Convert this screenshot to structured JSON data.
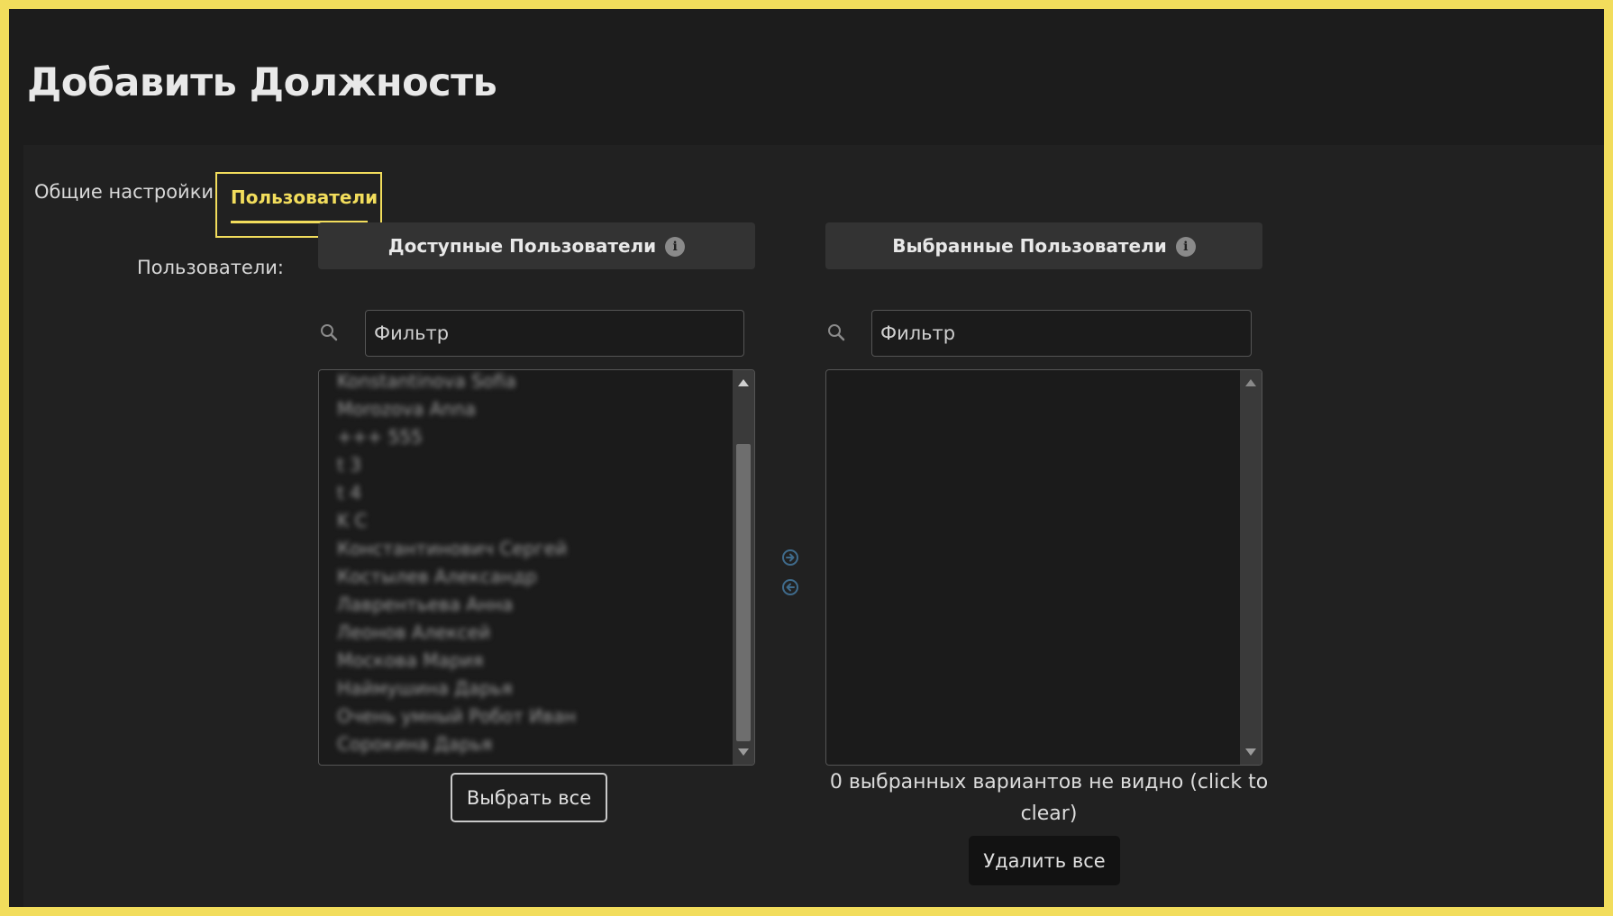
{
  "page": {
    "title": "Добавить Должность"
  },
  "tabs": [
    {
      "label": "Общие настройки",
      "active": false
    },
    {
      "label": "Пользователи",
      "active": true
    }
  ],
  "users_field": {
    "label": "Пользователи:",
    "available": {
      "title": "Доступные Пользователи",
      "filter_placeholder": "Фильтр",
      "options": [
        "Konstantinova Sofia",
        "Morozova Anna",
        "+++ 555",
        "t 3",
        "t 4",
        "K C",
        "Константинович Сергей",
        "Костылев Александр",
        "Лаврентьева Анна",
        "Леонов Алексей",
        "Москова Мария",
        "Наймушина Дарья",
        "Очень умный Робот Иван",
        "Сорокина Дарья"
      ],
      "select_all_label": "Выбрать все"
    },
    "selected": {
      "title": "Выбранные Пользователи",
      "filter_placeholder": "Фильтр",
      "options": [],
      "hidden_note": "0 выбранных вариантов не видно (click to clear)",
      "remove_all_label": "Удалить все"
    }
  },
  "colors": {
    "accent": "#f2dd5c",
    "background": "#1c1c1c",
    "panel": "#212121",
    "box_title": "#333333",
    "move_icon": "#3f6b8c"
  },
  "icons": {
    "search": "search-icon",
    "info": "info-icon",
    "add": "arrow-right-circle-icon",
    "remove": "arrow-left-circle-icon"
  }
}
